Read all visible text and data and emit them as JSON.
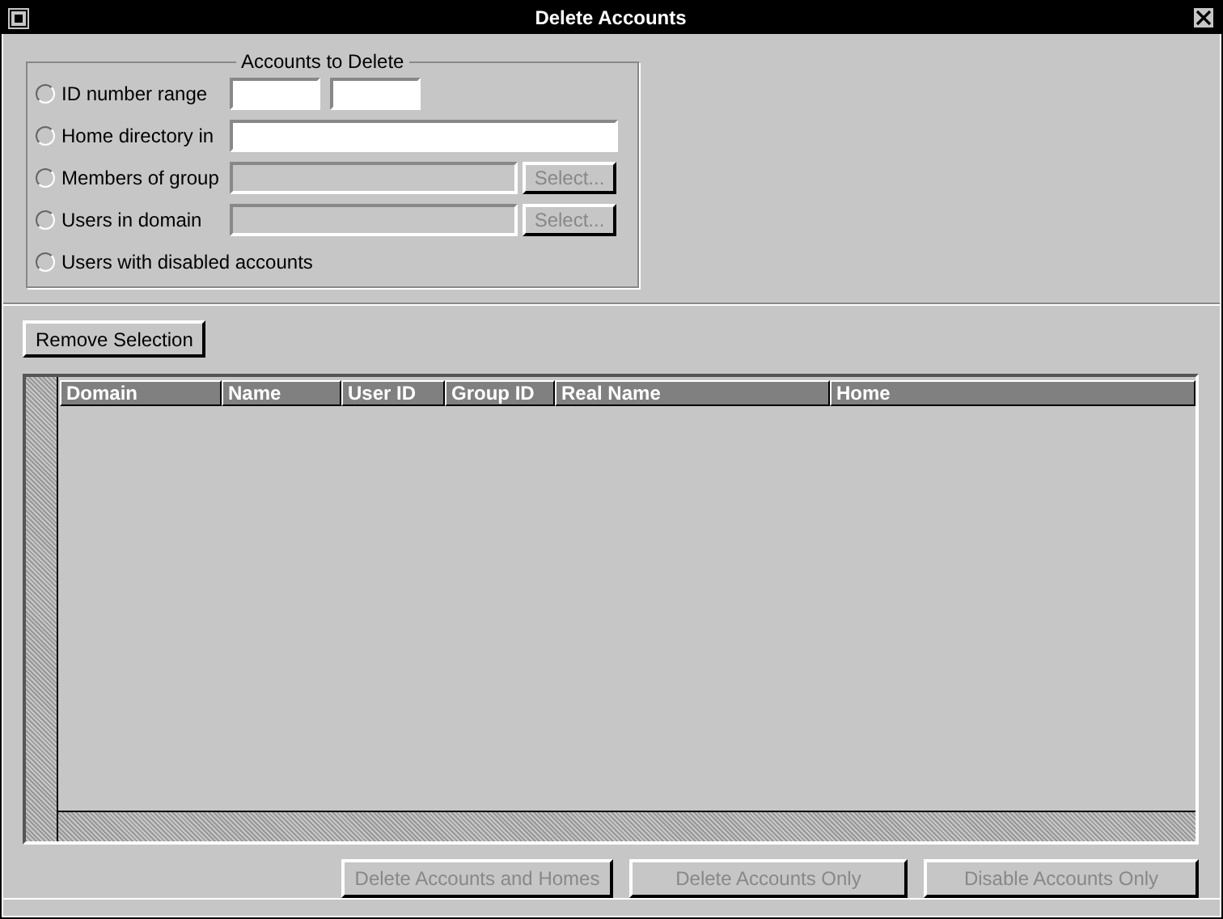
{
  "window": {
    "title": "Delete Accounts"
  },
  "criteria": {
    "legend": "Accounts to Delete",
    "options": [
      {
        "kind": "range",
        "label": "ID number range",
        "selected": false,
        "fields": [
          {
            "disabled": false
          },
          {
            "disabled": false
          }
        ]
      },
      {
        "kind": "text",
        "label": "Home directory in",
        "selected": false,
        "fields": [
          {
            "disabled": false
          }
        ]
      },
      {
        "kind": "select",
        "label": "Members of group",
        "selected": false,
        "fields": [
          {
            "disabled": true
          }
        ],
        "button": {
          "label": "Select...",
          "disabled": true
        }
      },
      {
        "kind": "select",
        "label": "Users in domain",
        "selected": false,
        "fields": [
          {
            "disabled": true
          }
        ],
        "button": {
          "label": "Select...",
          "disabled": true
        }
      },
      {
        "kind": "none",
        "label": "Users with disabled accounts",
        "selected": false
      }
    ]
  },
  "remove_button": {
    "label": "Remove Selection",
    "disabled": false
  },
  "table": {
    "columns": [
      "Domain",
      "Name",
      "User ID",
      "Group ID",
      "Real Name",
      "Home"
    ]
  },
  "buttons": [
    {
      "label": "Delete Accounts and Homes",
      "disabled": true
    },
    {
      "label": "Delete Accounts Only",
      "disabled": true
    },
    {
      "label": "Disable Accounts Only",
      "disabled": true
    }
  ]
}
